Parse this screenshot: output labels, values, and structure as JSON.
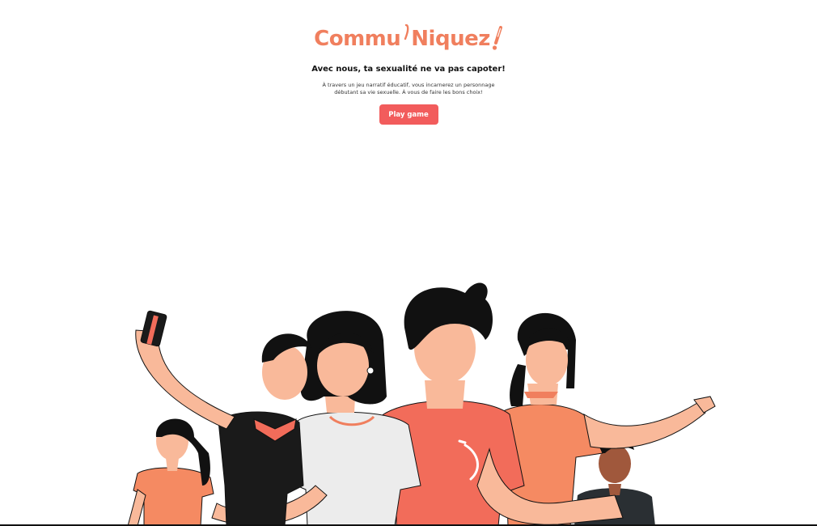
{
  "brand": {
    "name_part1": "Commu",
    "name_part2": "Niquez",
    "accent_color": "#f07f5e",
    "button_color": "#f25c5c"
  },
  "hero": {
    "tagline": "Avec nous, ta sexualité ne va pas capoter!",
    "description": "À travers un jeu narratif éducatif, vous incarnerez un personnage débutant sa vie sexuelle. À vous de faire les bons choix!",
    "play_label": "Play game"
  },
  "illustration": {
    "subject": "group-of-young-people-selfie"
  }
}
